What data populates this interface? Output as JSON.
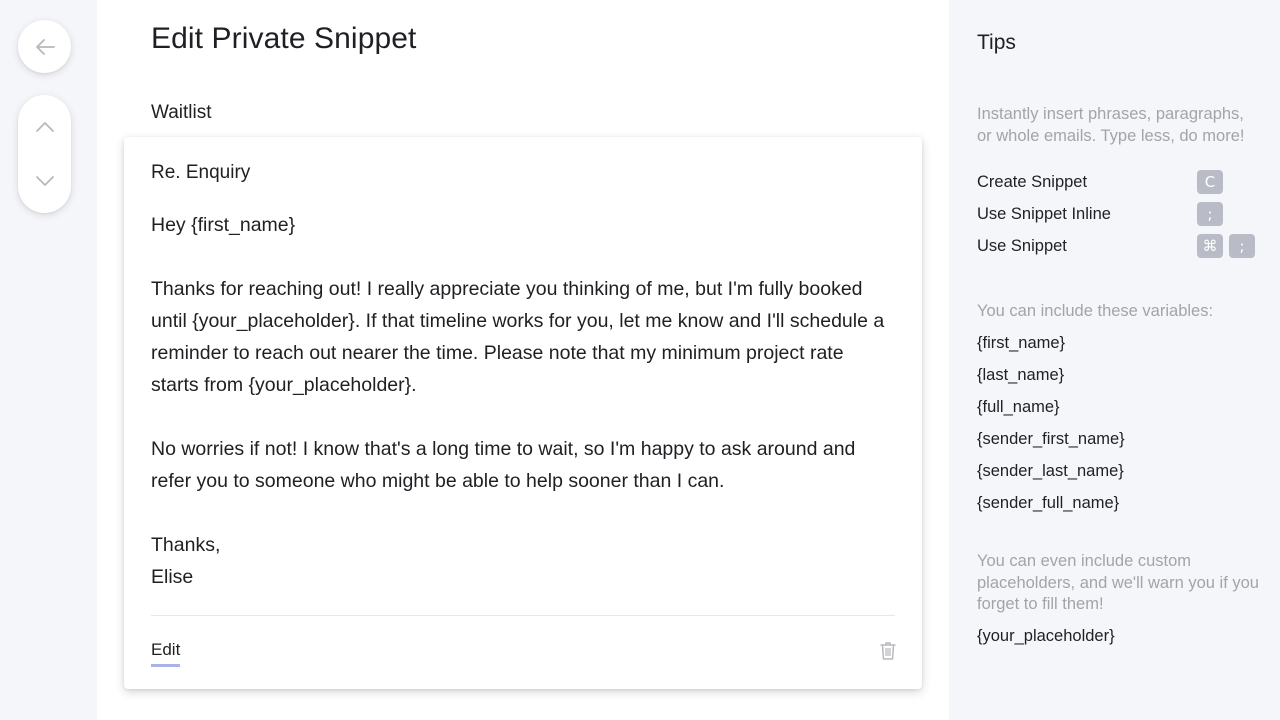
{
  "page": {
    "title": "Edit Private Snippet",
    "snippet_name": "Waitlist"
  },
  "card": {
    "subject": "Re. Enquiry",
    "body": {
      "greeting": "Hey {first_name}",
      "paragraph_1": "Thanks for reaching out! I really appreciate you thinking of me, but I'm fully booked until {your_placeholder}. If that timeline works for you, let me know and I'll schedule a reminder to reach out nearer the time. Please note that my minimum project rate starts from {your_placeholder}.",
      "paragraph_2": "No worries if not! I know that's a long time to wait, so I'm happy to ask around and refer you to someone who might be able to help sooner than I can.",
      "signoff_1": "Thanks,",
      "signoff_2": "Elise"
    },
    "edit_label": "Edit",
    "delete_icon": "trash-icon"
  },
  "nav": {
    "back_icon": "arrow-left-icon",
    "up_icon": "chevron-up-icon",
    "down_icon": "chevron-down-icon"
  },
  "tips": {
    "title": "Tips",
    "intro": "Instantly insert phrases, paragraphs, or whole emails. Type less, do more!",
    "shortcuts": [
      {
        "label": "Create Snippet",
        "keys": [
          "C"
        ]
      },
      {
        "label": "Use Snippet Inline",
        "keys": [
          ";"
        ]
      },
      {
        "label": "Use Snippet",
        "keys": [
          "⌘",
          ";"
        ]
      }
    ],
    "variables_intro": "You can include these variables:",
    "variables": [
      "{first_name}",
      "{last_name}",
      "{full_name}",
      "{sender_first_name}",
      "{sender_last_name}",
      "{sender_full_name}"
    ],
    "custom_intro": "You can even include custom placeholders, and we'll warn you if you forget to fill them!",
    "custom_variable": "{your_placeholder}"
  },
  "colors": {
    "background": "#f5f6fa",
    "card": "#ffffff",
    "muted_text": "#a3a3aa",
    "key_badge": "#b9bcc6",
    "edit_underline": "#a9b3e8"
  }
}
